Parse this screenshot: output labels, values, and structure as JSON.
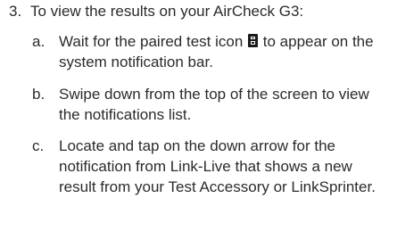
{
  "step": {
    "number": "3.",
    "text": "To view the results on your AirCheck G3:",
    "substeps": [
      {
        "letter": "a.",
        "text_before_icon": "Wait for the paired test icon",
        "icon": "paired-test-icon",
        "text_after_icon": " to appear on the system notification bar."
      },
      {
        "letter": "b.",
        "text": "Swipe down from the top of the screen to view the notifications list."
      },
      {
        "letter": "c.",
        "text": "Locate and tap on the down arrow for the notification from Link-Live that shows a new result from your Test Accessory or LinkSprinter."
      }
    ]
  }
}
